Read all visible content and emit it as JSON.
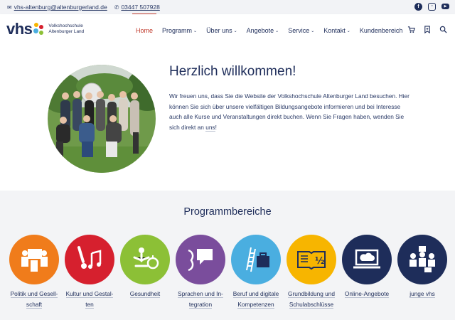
{
  "topbar": {
    "email": "vhs-altenburg@altenburgerland.de",
    "phone": "03447 507928",
    "social": [
      "facebook-icon",
      "instagram-icon",
      "youtube-icon"
    ]
  },
  "logo": {
    "text": "vhs",
    "line1": "Volkshochschule",
    "line2": "Altenburger Land"
  },
  "nav": {
    "items": [
      {
        "label": "Home",
        "active": true
      },
      {
        "label": "Programm",
        "dropdown": true
      },
      {
        "label": "Über uns",
        "dropdown": true
      },
      {
        "label": "Angebote",
        "dropdown": true
      },
      {
        "label": "Service",
        "dropdown": true
      },
      {
        "label": "Kontakt",
        "dropdown": true
      },
      {
        "label": "Kundenbereich"
      }
    ],
    "icons": [
      "cart-icon",
      "bookmark-icon",
      "search-icon"
    ]
  },
  "welcome": {
    "title": "Herzlich willkommen!",
    "text": "Wir freuen uns, dass Sie die Website der Volkshochschule Altenburger Land besuchen. Hier können Sie sich über unsere vielfältigen Bildungsangebote informieren und bei Interesse auch alle Kurse und Veranstaltungen direkt buchen. Wenn Sie Fragen haben, wenden Sie sich direkt an",
    "link": "uns",
    "end": "!"
  },
  "programs": {
    "title": "Programmbereiche",
    "items": [
      {
        "label": "Politik und Gesell-schaft",
        "color": "#f07c1b",
        "icon": "people-board-icon"
      },
      {
        "label": "Kultur und Gestal-ten",
        "color": "#d6202e",
        "icon": "brush-music-icon"
      },
      {
        "label": "Gesundheit",
        "color": "#8cc036",
        "icon": "yoga-apple-icon"
      },
      {
        "label": "Sprachen und In-tegration",
        "color": "#7a4d9c",
        "icon": "speech-bubble-icon"
      },
      {
        "label": "Beruf und digitale Kompetenzen",
        "color": "#4aaee0",
        "icon": "ladder-briefcase-icon"
      },
      {
        "label": "Grundbildung und Schulabschlüsse",
        "color": "#f7b500",
        "icon": "book-half-icon"
      },
      {
        "label": "Online-Angebote",
        "color": "#1e2d5a",
        "icon": "laptop-cloud-icon"
      },
      {
        "label": "junge vhs",
        "color": "#1e2d5a",
        "icon": "youth-group-icon"
      }
    ]
  }
}
